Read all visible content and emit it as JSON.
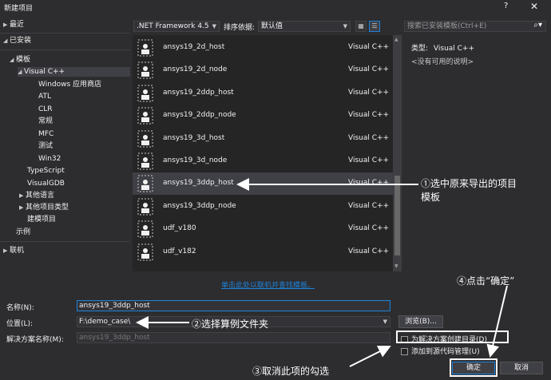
{
  "window": {
    "title": "新建项目",
    "help_glyph": "?",
    "close_glyph": "✕"
  },
  "tree": {
    "recent": "最近",
    "installed": "已安装",
    "templates": "模板",
    "visual_cpp": "Visual C++",
    "windows_store": "Windows 应用商店",
    "atl": "ATL",
    "clr": "CLR",
    "general": "常规",
    "mfc": "MFC",
    "test": "测试",
    "win32": "Win32",
    "typescript": "TypeScript",
    "visualgdb": "VisualGDB",
    "other_languages": "其他语言",
    "other_project_types": "其他项目类型",
    "build_template": "建模项目",
    "samples": "示例",
    "online": "联机"
  },
  "toolbar": {
    "framework": ".NET Framework 4.5",
    "sort_label": "排序依据:",
    "sort_value": "默认值",
    "search_placeholder": "搜索已安装模板(Ctrl+E)"
  },
  "templates": [
    {
      "name": "ansys19_2d_host",
      "lang": "Visual C++"
    },
    {
      "name": "ansys19_2d_node",
      "lang": "Visual C++"
    },
    {
      "name": "ansys19_2ddp_host",
      "lang": "Visual C++"
    },
    {
      "name": "ansys19_2ddp_node",
      "lang": "Visual C++"
    },
    {
      "name": "ansys19_3d_host",
      "lang": "Visual C++"
    },
    {
      "name": "ansys19_3d_node",
      "lang": "Visual C++"
    },
    {
      "name": "ansys19_3ddp_host",
      "lang": "Visual C++"
    },
    {
      "name": "ansys19_3ddp_node",
      "lang": "Visual C++"
    },
    {
      "name": "udf_v180",
      "lang": "Visual C++"
    },
    {
      "name": "udf_v182",
      "lang": "Visual C++"
    }
  ],
  "details": {
    "type_label": "类型:",
    "type_value": "Visual C++",
    "no_description": "<没有可用的说明>"
  },
  "online_link": "单击此处以联机并查找模板。",
  "form": {
    "name_label": "名称(N):",
    "name_value": "ansys19_3ddp_host",
    "location_label": "位置(L):",
    "location_value": "F:\\demo_case\\",
    "solution_label": "解决方案名称(M):",
    "solution_value": "ansys19_3ddp_host",
    "browse_label": "浏览(B)...",
    "create_dir_label": "为解决方案创建目录(D)",
    "add_source_control_label": "添加到源代码管理(U)",
    "ok_label": "确定",
    "cancel_label": "取消"
  },
  "annotations": {
    "note1_line1": "①选中原来导出的项目",
    "note1_line2": "模板",
    "note2": "②选择算例文件夹",
    "note3": "③取消此项的勾选",
    "note4": "④点击“确定”"
  },
  "colors": {
    "background": "#2d2d30",
    "list_background": "#252526",
    "selection": "#3f3f46",
    "accent": "#1e82d8",
    "annotation": "#ffffff"
  }
}
